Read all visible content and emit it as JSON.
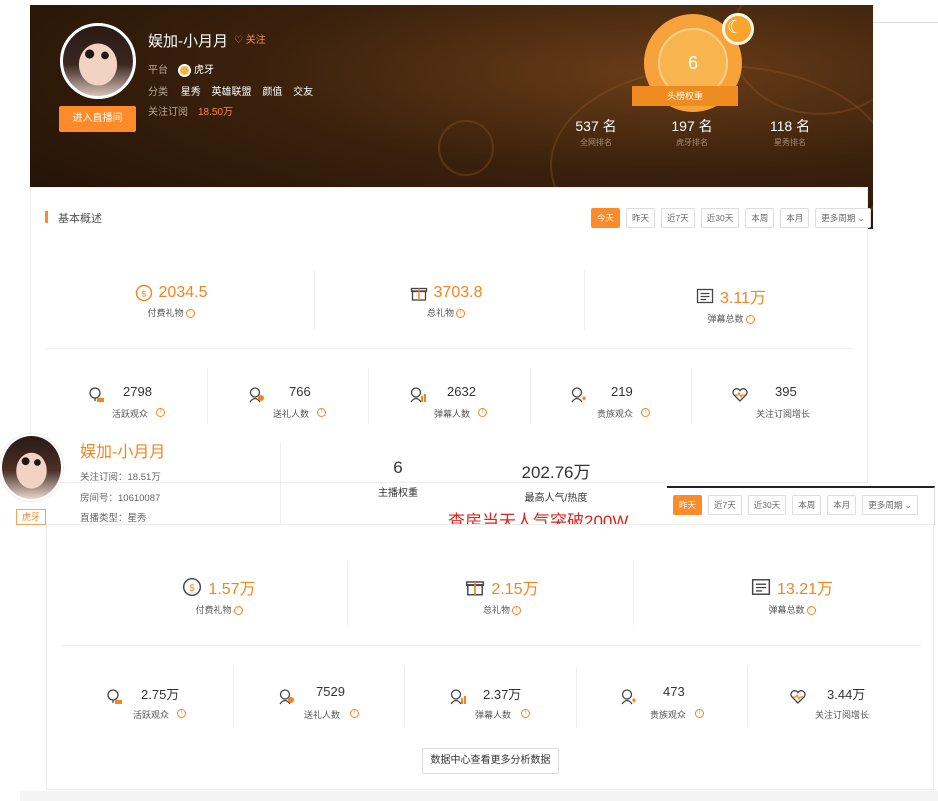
{
  "panel_a": {
    "streamer_name": "娱加-小月月",
    "follow_label": "♡ 关注",
    "platform_label": "平台",
    "platform_value": "虎牙",
    "category_label": "分类",
    "category_tags": [
      "星秀",
      "英雄联盟",
      "颜值",
      "交友"
    ],
    "subscribers_label": "关注订阅",
    "subscribers_value": "18.50万",
    "enter_button": "进入直播间",
    "medal_value": "6",
    "medal_caption": "头榜权重",
    "ranks": [
      {
        "value": "537 名",
        "label": "全网排名"
      },
      {
        "value": "197 名",
        "label": "虎牙排名"
      },
      {
        "value": "118 名",
        "label": "星秀排名"
      }
    ],
    "section_title": "基本概述",
    "periods": [
      "今天",
      "昨天",
      "近7天",
      "近30天",
      "本周",
      "本月",
      "更多周期 ⌄"
    ],
    "active_period": "今天",
    "big_stats": [
      {
        "value": "2034.5",
        "label": "付费礼物",
        "icon": "coin-icon"
      },
      {
        "value": "3703.8",
        "label": "总礼物",
        "icon": "gift-icon"
      },
      {
        "value": "3.11万",
        "label": "弹幕总数",
        "icon": "barrage-icon"
      }
    ],
    "small_stats": [
      {
        "value": "2798",
        "label": "活跃观众",
        "icon": "active-viewer-icon"
      },
      {
        "value": "766",
        "label": "送礼人数",
        "icon": "gifter-icon"
      },
      {
        "value": "2632",
        "label": "弹幕人数",
        "icon": "barrage-user-icon"
      },
      {
        "value": "219",
        "label": "贵族观众",
        "icon": "noble-viewer-icon"
      },
      {
        "value": "395",
        "label": "关注订阅增长",
        "icon": "heart-growth-icon"
      }
    ]
  },
  "overlay": {
    "name": "娱加-小月月",
    "platform_badge": "虎牙",
    "subscribers": "关注订阅：18.51万",
    "room_id": "房间号：10610087",
    "stream_type": "直播类型：星秀",
    "weight_value": "6",
    "weight_label": "主播权重",
    "peak_value": "202.76万",
    "peak_label": "最高人气/热度",
    "annotation": "查房当天人气突破200W"
  },
  "panel_b": {
    "periods": [
      "昨天",
      "近7天",
      "近30天",
      "本周",
      "本月",
      "更多周期 ⌄"
    ],
    "active_period": "昨天",
    "big_stats": [
      {
        "value": "1.57万",
        "label": "付费礼物",
        "icon": "coin-icon"
      },
      {
        "value": "2.15万",
        "label": "总礼物",
        "icon": "gift-icon"
      },
      {
        "value": "13.21万",
        "label": "弹幕总数",
        "icon": "barrage-icon"
      }
    ],
    "small_stats": [
      {
        "value": "2.75万",
        "label": "活跃观众",
        "icon": "active-viewer-icon"
      },
      {
        "value": "7529",
        "label": "送礼人数",
        "icon": "gifter-icon"
      },
      {
        "value": "2.37万",
        "label": "弹幕人数",
        "icon": "barrage-user-icon"
      },
      {
        "value": "473",
        "label": "贵族观众",
        "icon": "noble-viewer-icon"
      },
      {
        "value": "3.44万",
        "label": "关注订阅增长",
        "icon": "heart-growth-icon"
      }
    ],
    "more_button": "数据中心查看更多分析数据"
  }
}
